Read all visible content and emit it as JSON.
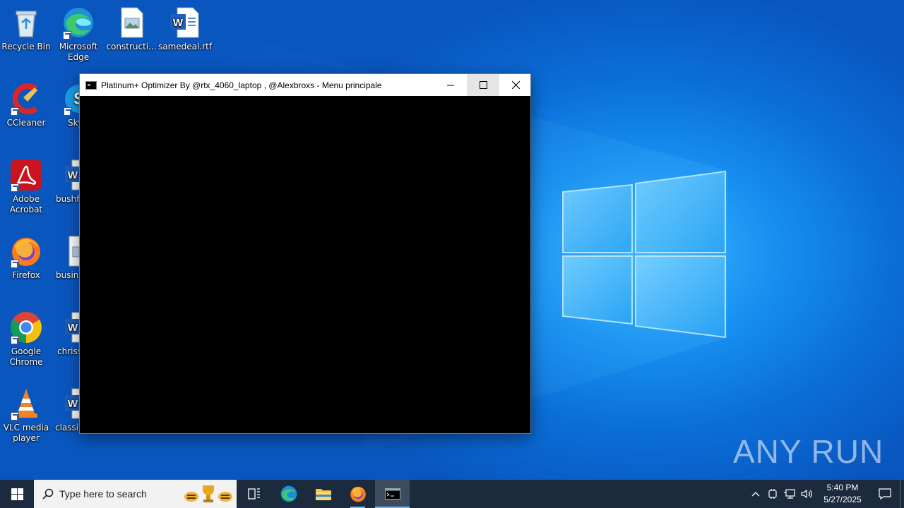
{
  "desktop": {
    "icons": [
      {
        "label": "Recycle Bin"
      },
      {
        "label": "Microsoft Edge"
      },
      {
        "label": "constructi..."
      },
      {
        "label": "samedeal.rtf"
      },
      {
        "label": "CCleaner"
      },
      {
        "label": "Sky"
      },
      {
        "label": "Adobe Acrobat"
      },
      {
        "label": "bushfr"
      },
      {
        "label": "Firefox"
      },
      {
        "label": "busine"
      },
      {
        "label": "Google Chrome"
      },
      {
        "label": "chriss"
      },
      {
        "label": "VLC media player"
      },
      {
        "label": "classic"
      }
    ]
  },
  "console": {
    "title": "Platinum+ Optimizer By @rtx_4060_laptop , @Alexbroxs - Menu principale"
  },
  "watermark": {
    "text": "ANY RUN"
  },
  "taskbar": {
    "search_placeholder": "Type here to search",
    "time": "5:40 PM",
    "date": "5/27/2025"
  },
  "colors": {
    "wallpaper": "#0b6fd9",
    "taskbar": "#1b2a3c",
    "console_bg": "#000000",
    "accent": "#76b9ed"
  }
}
